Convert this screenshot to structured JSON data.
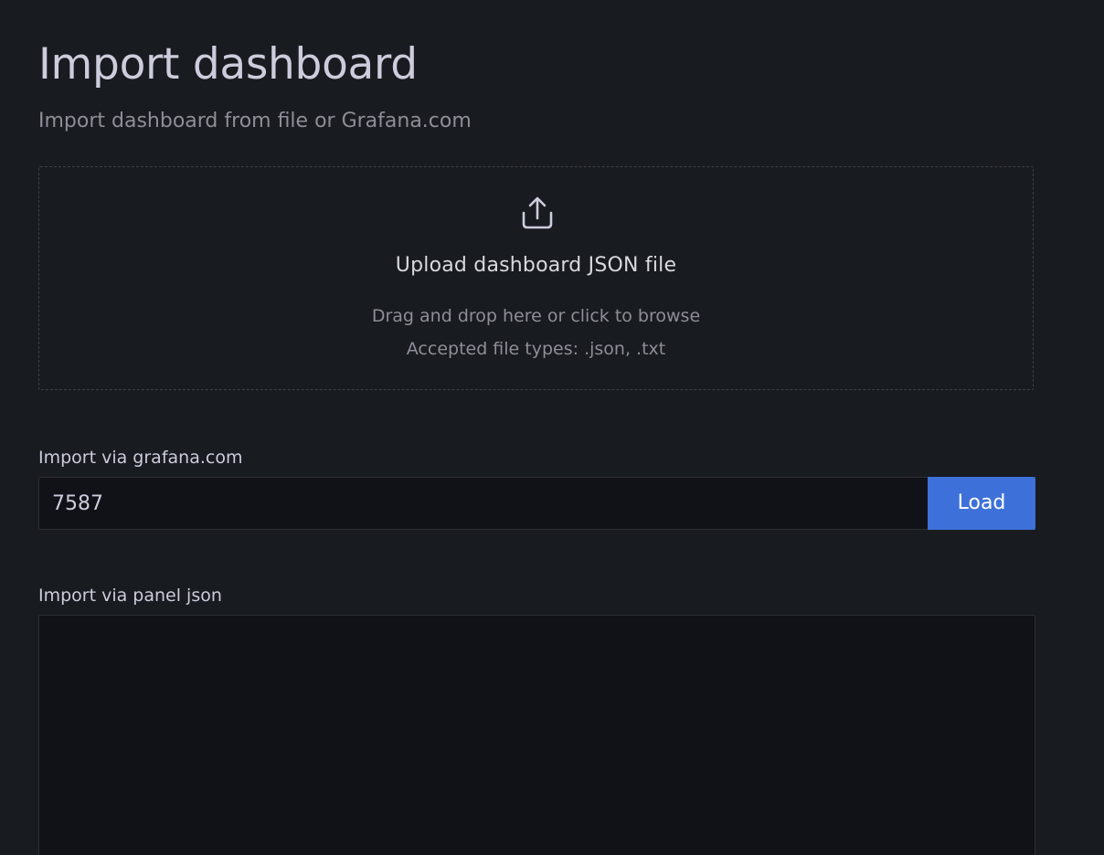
{
  "page": {
    "title": "Import dashboard",
    "subtitle": "Import dashboard from file or Grafana.com"
  },
  "upload": {
    "icon": "upload-icon",
    "title": "Upload dashboard JSON file",
    "hint_drag": "Drag and drop here or click to browse",
    "hint_types": "Accepted file types: .json, .txt"
  },
  "grafana_com": {
    "label": "Import via grafana.com",
    "value": "7587",
    "load_label": "Load"
  },
  "panel_json": {
    "label": "Import via panel json",
    "value": ""
  },
  "colors": {
    "background": "#181b1f",
    "input_background": "#111217",
    "primary_button": "#3d71d9",
    "text_primary": "#ccccdc",
    "text_secondary": "#8e8e98"
  }
}
